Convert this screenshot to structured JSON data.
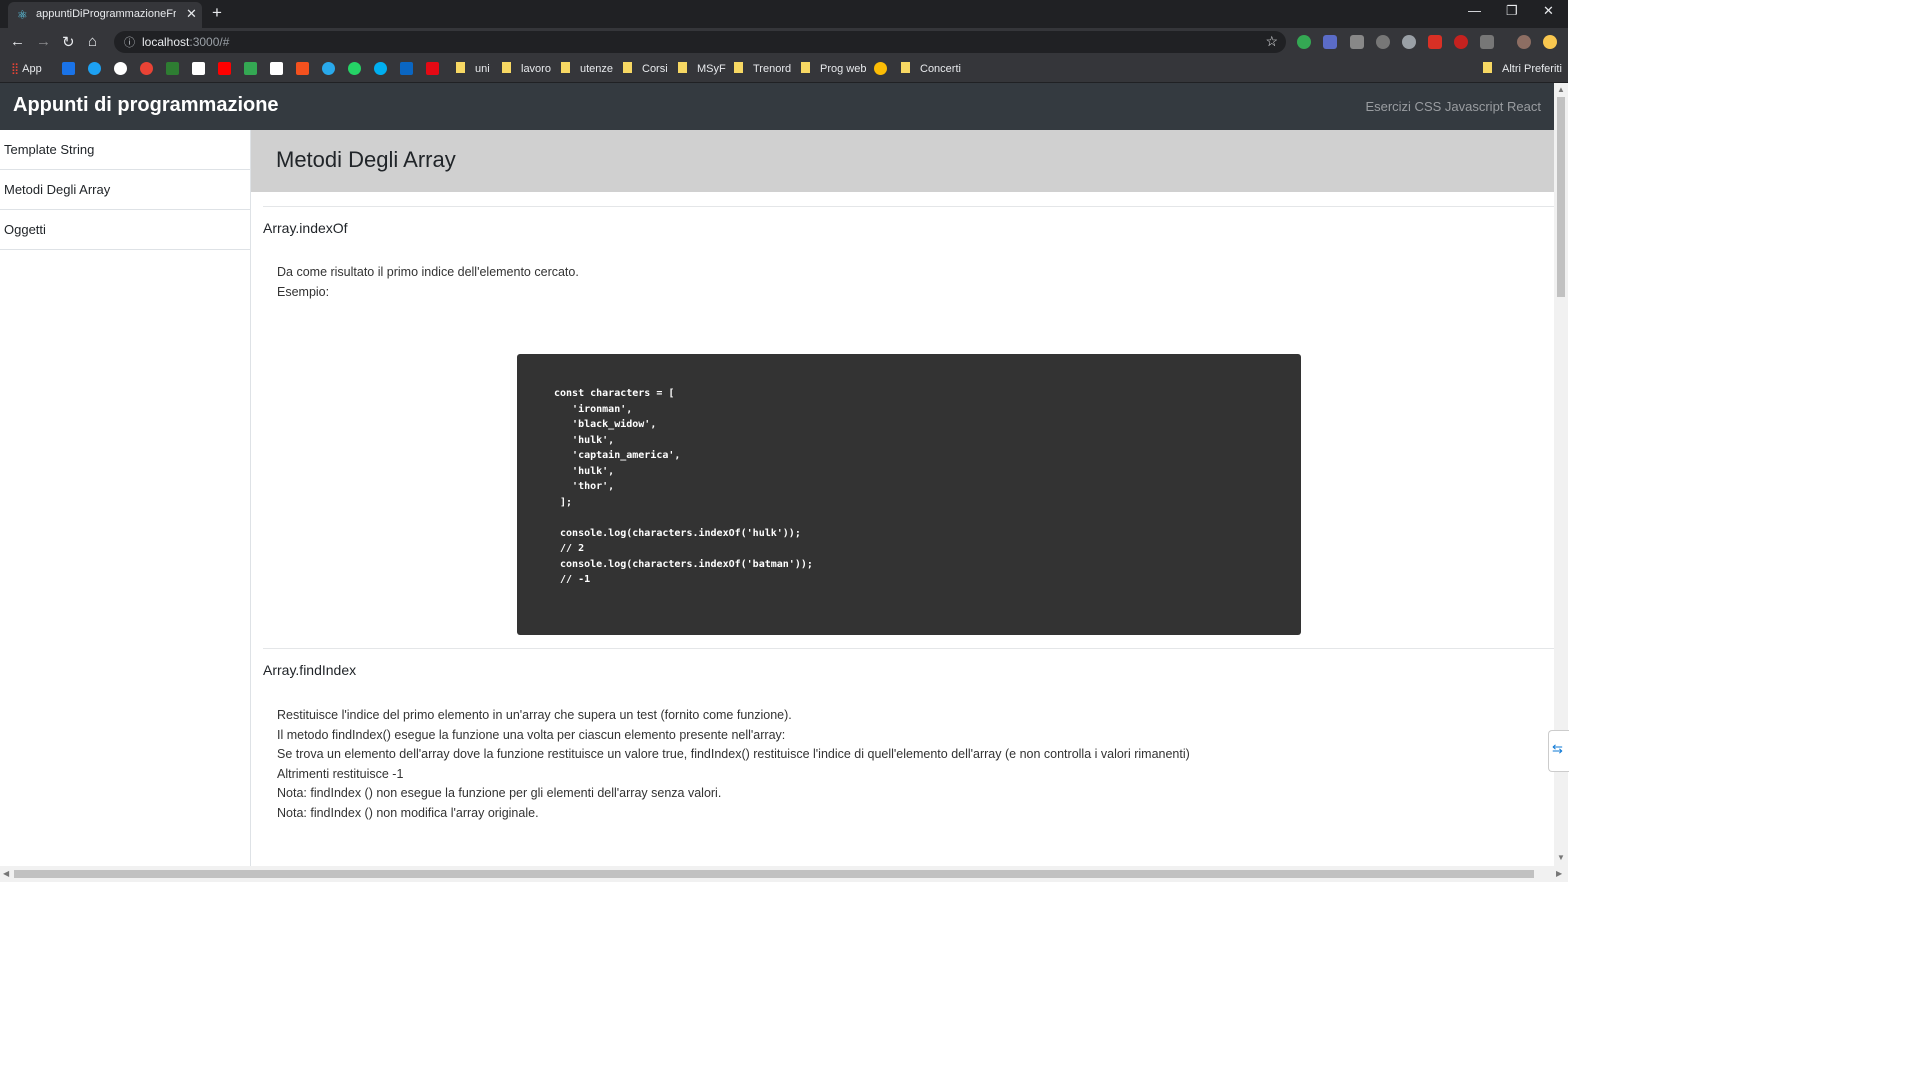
{
  "browser": {
    "tab_title": "appuntiDiProgrammazioneFront",
    "tab_close": "✕",
    "new_tab": "+",
    "window_controls": {
      "minimize": "—",
      "restore": "❐",
      "close": "✕"
    },
    "nav": {
      "back": "←",
      "forward": "→",
      "reload": "↻",
      "home": "⌂"
    },
    "url_host": "localhost",
    "url_path": ":3000/#",
    "bookmarks": {
      "apps": "App",
      "folders": [
        "uni",
        "lavoro",
        "utenze",
        "Corsi",
        "MSyF",
        "Trenord",
        "Prog web",
        "Concerti"
      ],
      "other": "Altri Preferiti"
    }
  },
  "header": {
    "brand": "Appunti di programmazione",
    "links": "Esercizi CSS Javascript React"
  },
  "sidebar": {
    "items": [
      {
        "label": "Template String"
      },
      {
        "label": "Metodi Degli Array"
      },
      {
        "label": "Oggetti"
      }
    ]
  },
  "main": {
    "page_title": "Metodi Degli Array",
    "sections": [
      {
        "title": "Array.indexOf",
        "lines": [
          "Da come risultato il primo indice dell'elemento cercato.",
          "Esempio:"
        ],
        "code": "const characters = [\n   'ironman',\n   'black_widow',\n   'hulk',\n   'captain_america',\n   'hulk',\n   'thor',\n ];\n\n console.log(characters.indexOf('hulk'));\n // 2\n console.log(characters.indexOf('batman'));\n // -1"
      },
      {
        "title": "Array.findIndex",
        "lines": [
          "Restituisce l'indice del primo elemento in un'array che supera un test (fornito come funzione).",
          "Il metodo findIndex() esegue la funzione una volta per ciascun elemento presente nell'array:",
          "Se trova un elemento dell'array dove la funzione restituisce un valore true, findIndex() restituisce l'indice di quell'elemento dell'array (e non controlla i valori rimanenti)",
          "Altrimenti restituisce -1",
          "Nota: findIndex () non esegue la funzione per gli elementi dell'array senza valori.",
          "Nota: findIndex () non modifica l'array originale."
        ]
      }
    ]
  }
}
